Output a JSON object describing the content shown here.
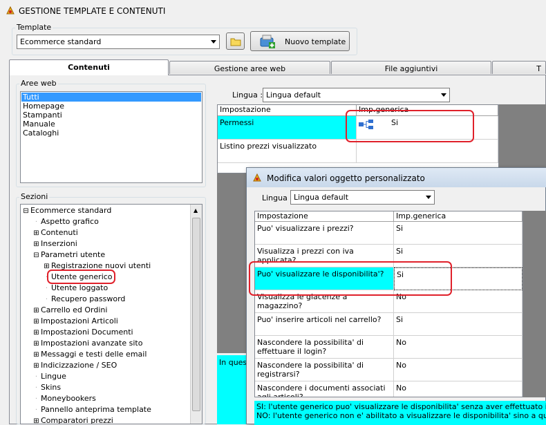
{
  "window": {
    "title": "GESTIONE TEMPLATE E CONTENUTI"
  },
  "template": {
    "label": "Template",
    "selected": "Ecommerce standard",
    "new_button": "Nuovo template"
  },
  "tabs": [
    {
      "label": "Contenuti",
      "active": true
    },
    {
      "label": "Gestione aree web",
      "active": false
    },
    {
      "label": "File aggiuntivi",
      "active": false
    },
    {
      "label": "T",
      "active": false
    }
  ],
  "aree_web": {
    "label": "Aree web",
    "items": [
      "Tutti",
      "Homepage",
      "Stampanti",
      "Manuale",
      "Cataloghi"
    ],
    "selected_index": 0
  },
  "sezioni": {
    "label": "Sezioni",
    "tree": [
      {
        "text": "Ecommerce standard",
        "level": 0,
        "exp": "−"
      },
      {
        "text": "Aspetto grafico",
        "level": 1,
        "exp": ""
      },
      {
        "text": "Contenuti",
        "level": 1,
        "exp": "+"
      },
      {
        "text": "Inserzioni",
        "level": 1,
        "exp": "+"
      },
      {
        "text": "Parametri utente",
        "level": 1,
        "exp": "−"
      },
      {
        "text": "Registrazione nuovi utenti",
        "level": 2,
        "exp": "+"
      },
      {
        "text": "Utente generico",
        "level": 2,
        "exp": ""
      },
      {
        "text": "Utente loggato",
        "level": 2,
        "exp": ""
      },
      {
        "text": "Recupero password",
        "level": 2,
        "exp": ""
      },
      {
        "text": "Carrello ed Ordini",
        "level": 1,
        "exp": "+"
      },
      {
        "text": "Impostazioni Articoli",
        "level": 1,
        "exp": "+"
      },
      {
        "text": "Impostazioni Documenti",
        "level": 1,
        "exp": "+"
      },
      {
        "text": "Impostazioni avanzate sito",
        "level": 1,
        "exp": "+"
      },
      {
        "text": "Messaggi e testi delle email",
        "level": 1,
        "exp": "+"
      },
      {
        "text": "Indicizzazione / SEO",
        "level": 1,
        "exp": "+"
      },
      {
        "text": "Lingue",
        "level": 1,
        "exp": ""
      },
      {
        "text": "Skins",
        "level": 1,
        "exp": ""
      },
      {
        "text": "Moneybookers",
        "level": 1,
        "exp": ""
      },
      {
        "text": "Pannello anteprima template",
        "level": 1,
        "exp": ""
      },
      {
        "text": "Comparatori prezzi",
        "level": 1,
        "exp": "+"
      }
    ]
  },
  "main": {
    "lingua_label": "Lingua :",
    "lingua_value": "Lingua default",
    "grid_headers": [
      "Impostazione",
      "Imp.generica"
    ],
    "rows": [
      {
        "name": "Permessi",
        "value": "Si"
      },
      {
        "name": "Listino prezzi visualizzato",
        "value": ""
      }
    ],
    "info_partial": "In quest"
  },
  "dialog": {
    "title": "Modifica valori oggetto personalizzato",
    "lingua_label": "Lingua :",
    "lingua_value": "Lingua default",
    "headers": [
      "Impostazione",
      "Imp.generica"
    ],
    "rows": [
      {
        "name": "Puo' visualizzare i prezzi?",
        "value": "Si"
      },
      {
        "name": "Visualizza i prezzi con iva applicata?",
        "value": "Si"
      },
      {
        "name": "Puo' visualizzare le disponibilita'?",
        "value": "Si"
      },
      {
        "name": "Visualizza le giacenze a magazzino?",
        "value": "No"
      },
      {
        "name": "Puo' inserire articoli nel carrello?",
        "value": "Si"
      },
      {
        "name": "Nascondere la possibilita' di effettuare il login?",
        "value": "No"
      },
      {
        "name": "Nascondere la possibilita' di registrarsi?",
        "value": "No"
      },
      {
        "name": "Nascondere i documenti associati agli articoli?",
        "value": "No"
      }
    ],
    "info_lines": [
      "SI: l'utente generico puo' visualizzare le disponibilita' senza aver effettuato il login.",
      "NO: l'utente generico non e' abilitato a visualizzare le disponibilita' sino a quando non avr"
    ]
  },
  "colors": {
    "highlight": "#00ffff",
    "annotation": "#e0202a",
    "selection": "#3399ff"
  }
}
